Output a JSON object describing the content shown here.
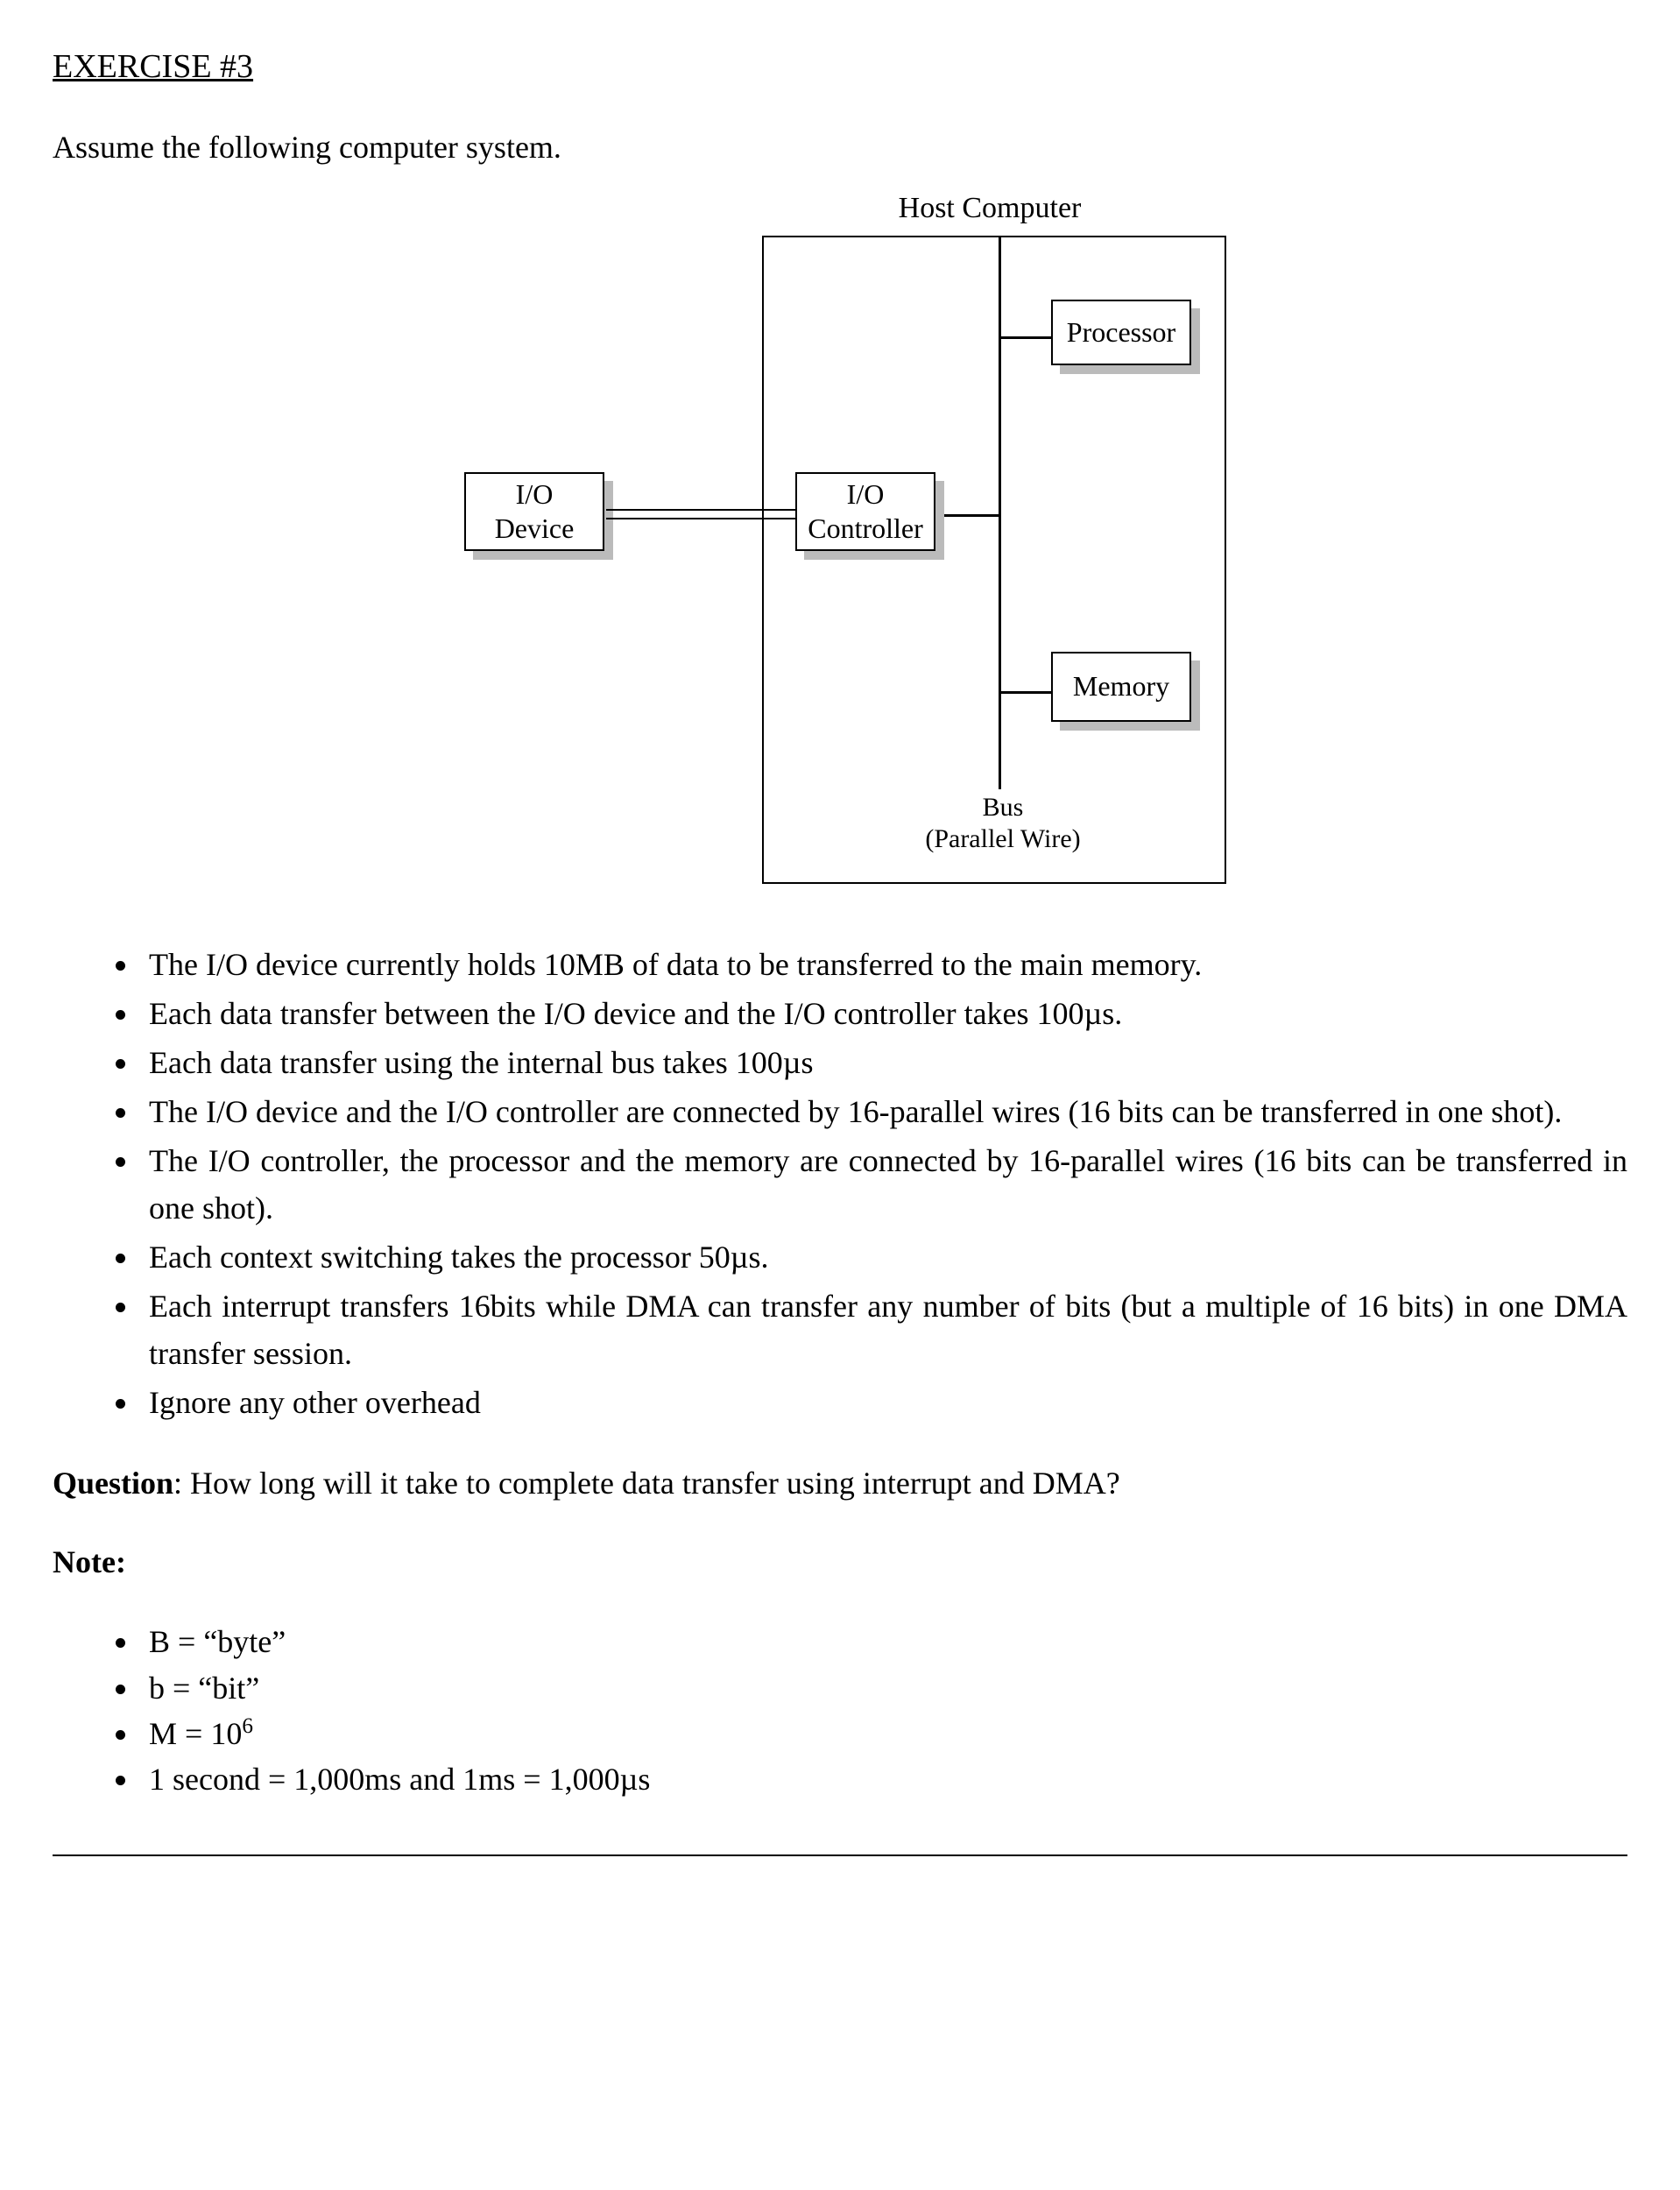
{
  "heading": "EXERCISE #3",
  "intro": "Assume the following computer system.",
  "diagram": {
    "host_label": "Host Computer",
    "io_device_l1": "I/O",
    "io_device_l2": "Device",
    "io_controller_l1": "I/O",
    "io_controller_l2": "Controller",
    "processor": "Processor",
    "memory": "Memory",
    "bus_l1": "Bus",
    "bus_l2": "(Parallel Wire)"
  },
  "bullets": [
    "The I/O device currently holds 10MB of data to be transferred to the main memory.",
    "Each data transfer between the I/O device and the I/O controller takes 100µs.",
    "Each data transfer using the internal bus takes 100µs",
    "The I/O device and the I/O controller are connected by 16-parallel wires (16 bits can be transferred in one shot).",
    "The I/O controller, the processor and the memory are connected by 16-parallel wires (16 bits can be transferred in one shot).",
    "Each context switching takes the processor 50µs.",
    "Each interrupt transfers 16bits while DMA can transfer any number of bits (but a multiple of 16 bits) in one DMA transfer session.",
    "Ignore any other overhead"
  ],
  "question_label": "Question",
  "question_text": ": How long will it take to complete data transfer using interrupt and DMA?",
  "note_label": "Note:",
  "notes": {
    "n0": "B = “byte”",
    "n1": "b = “bit”",
    "n2_pre": "M = 10",
    "n2_sup": "6",
    "n3": "1 second = 1,000ms and 1ms = 1,000µs"
  }
}
